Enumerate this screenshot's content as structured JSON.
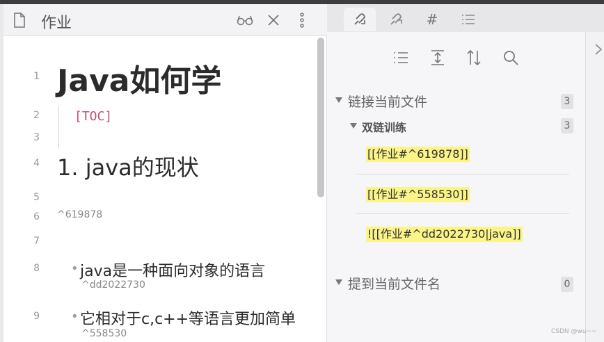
{
  "editor": {
    "title": "作业",
    "lines": [
      {
        "num": "1"
      },
      {
        "num": "2"
      },
      {
        "num": "3"
      },
      {
        "num": "4"
      },
      {
        "num": "5"
      },
      {
        "num": "6"
      },
      {
        "num": "7"
      },
      {
        "num": "8"
      },
      {
        "num": "9"
      }
    ],
    "heading1": "Java如何学",
    "toc": "[TOC]",
    "heading2": "1. java的现状",
    "block_id": "^619878",
    "list_items": [
      {
        "text": "java是一种面向对象的语言",
        "block_id": "^dd2022730"
      },
      {
        "text": "它相对于c,c++等语言更加简单",
        "block_id": "^558530"
      }
    ],
    "bullet": "•"
  },
  "right_panel": {
    "tabs": [
      {
        "icon": "backlinks-icon"
      },
      {
        "icon": "outgoing-links-icon"
      },
      {
        "icon": "hashtag-icon",
        "glyph": "#"
      },
      {
        "icon": "outline-icon"
      }
    ],
    "linked": {
      "title": "链接当前文件",
      "count": "3",
      "file": {
        "name": "双链训练",
        "count": "3",
        "links": [
          "[[作业#^619878]]",
          "[[作业#^558530]]",
          "![[作业#^dd2022730|java]]"
        ]
      }
    },
    "unlinked": {
      "title": "提到当前文件名",
      "count": "0"
    }
  },
  "watermark": "CSDN @wu~~"
}
